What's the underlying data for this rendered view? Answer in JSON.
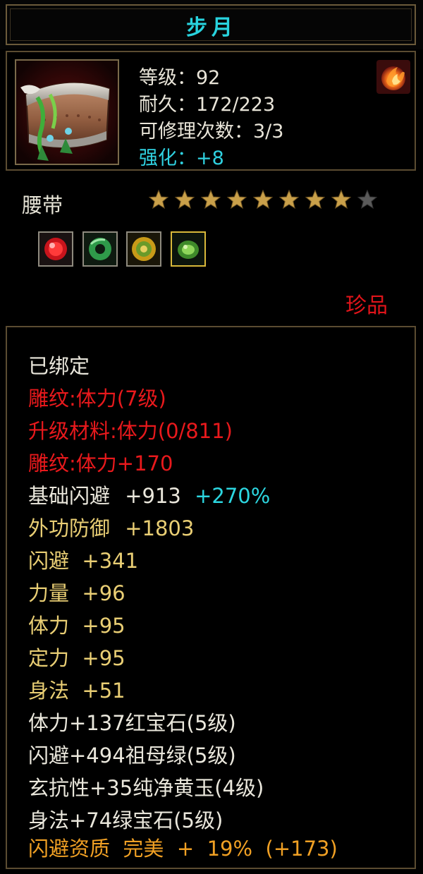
{
  "title": "步月",
  "info": {
    "level": "等级：92",
    "durability": "耐久：172/223",
    "repairs": "可修理次数：3/3",
    "enhance": "强化：+8"
  },
  "item_name": "腰带",
  "stars": {
    "total": 9,
    "filled": 8
  },
  "gems": [
    "ruby-gem-icon",
    "jade-ring-icon",
    "yellow-jade-icon",
    "emerald-icon"
  ],
  "rarity": "珍品",
  "attributes": {
    "bound": "已绑定",
    "engrave1": "雕纹:体力(7级)",
    "upgrade_material": "升级材料:体力(0/811)",
    "engrave2": "雕纹:体力+170",
    "base_dodge_label": "基础闪避",
    "base_dodge_value": "+913",
    "base_dodge_bonus": "+270%",
    "ext_defense_label": "外功防御",
    "ext_defense_value": "+1803",
    "dodge": "闪避  +341",
    "strength": "力量  +96",
    "stamina": "体力  +95",
    "focus": "定力  +95",
    "agility": "身法  +51",
    "gem1": "体力+137红宝石(5级)",
    "gem2": "闪避+494祖母绿(5级)",
    "gem3": "玄抗性+35纯净黄玉(4级)",
    "gem4": "身法+74绿宝石(5级)",
    "quality": "闪避资质  完美  +  19%  (+173)"
  },
  "colors": {
    "title": "#28d3de",
    "bound": "#eae7dc",
    "engrave": "#e8191c",
    "base_stat": "#e9ce74",
    "enhance": "#2cd6e0",
    "quality": "#f0a024",
    "rarity": "#e0141a"
  }
}
